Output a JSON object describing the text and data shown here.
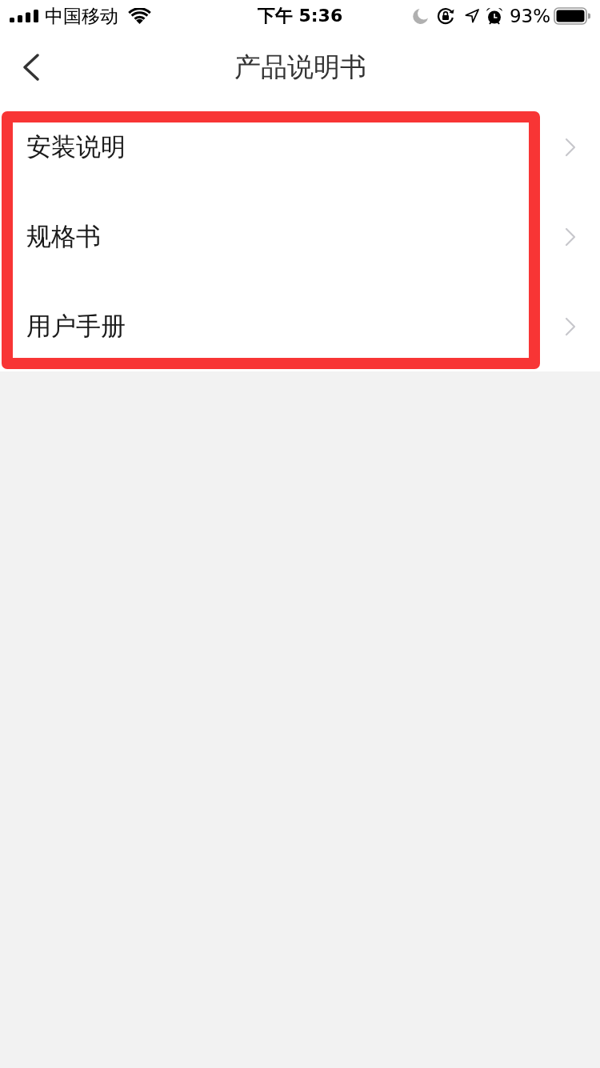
{
  "status_bar": {
    "carrier": "中国移动",
    "time": "下午 5:36",
    "battery": "93%"
  },
  "nav_bar": {
    "title": "产品说明书"
  },
  "list": {
    "highlighted": true,
    "items": [
      {
        "label": "安装说明"
      },
      {
        "label": "规格书"
      },
      {
        "label": "用户手册"
      }
    ]
  }
}
